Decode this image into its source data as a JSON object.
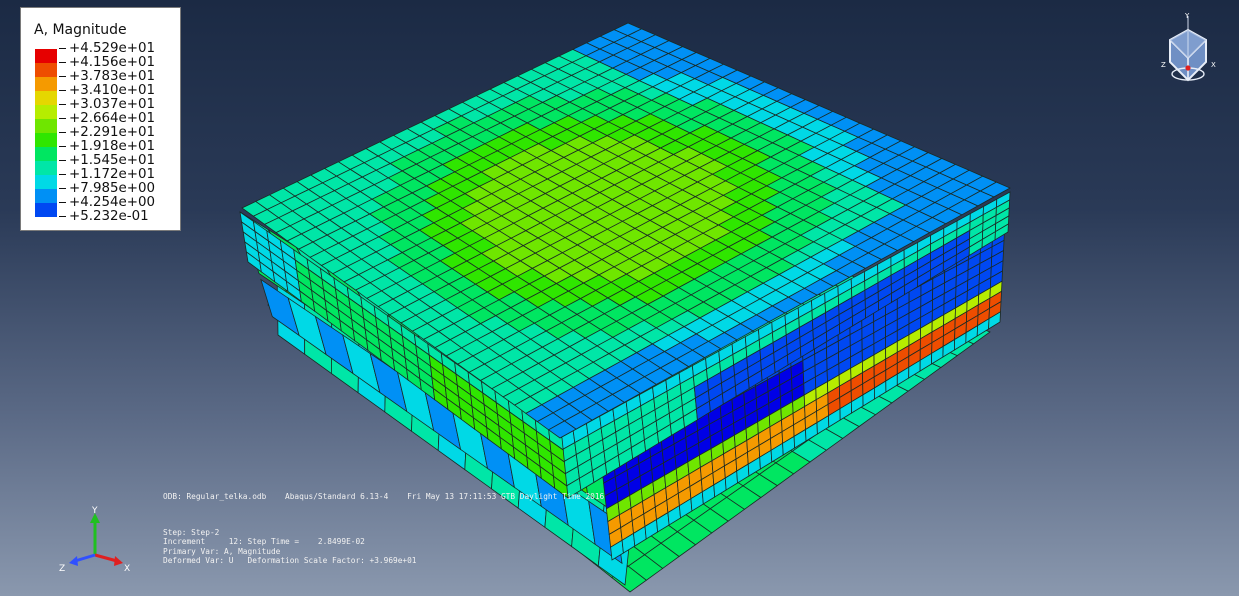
{
  "legend": {
    "title": "A, Magnitude",
    "entries": [
      {
        "label": "+4.529e+01",
        "color": "#e60000"
      },
      {
        "label": "+4.156e+01",
        "color": "#ee4d00"
      },
      {
        "label": "+3.783e+01",
        "color": "#f59a00"
      },
      {
        "label": "+3.410e+01",
        "color": "#e5d700"
      },
      {
        "label": "+3.037e+01",
        "color": "#b6ed00"
      },
      {
        "label": "+2.664e+01",
        "color": "#6fe600"
      },
      {
        "label": "+2.291e+01",
        "color": "#2fe600"
      },
      {
        "label": "+1.918e+01",
        "color": "#00e661"
      },
      {
        "label": "+1.545e+01",
        "color": "#00e6a7"
      },
      {
        "label": "+1.172e+01",
        "color": "#00d9e6"
      },
      {
        "label": "+7.985e+00",
        "color": "#0090f5"
      },
      {
        "label": "+4.254e+00",
        "color": "#0048f2"
      },
      {
        "label": "+5.232e-01",
        "color": "#0000e6"
      }
    ]
  },
  "info": {
    "odb_line": "ODB: Regular_telka.odb    Abaqus/Standard 6.13-4    Fri May 13 17:11:53 GTB Daylight Time 2016",
    "step_line": "Step: Step-2",
    "increment_line": "Increment     12: Step Time =    2.8499E-02",
    "primary_line": "Primary Var: A, Magnitude",
    "deformed_line": "Deformed Var: U   Deformation Scale Factor: +3.969e+01"
  },
  "triad": {
    "x_label": "X",
    "y_label": "Y",
    "z_label": "Z"
  },
  "view_cube": {
    "x_label": "X",
    "y_label": "Y",
    "z_label": "Z"
  },
  "colors": {
    "background_top": "#1b2a44",
    "background_bottom": "#8a98ae",
    "mesh_line": "#1a2a24",
    "triad_x": "#e02020",
    "triad_y": "#20c020",
    "triad_z": "#3050ff"
  }
}
